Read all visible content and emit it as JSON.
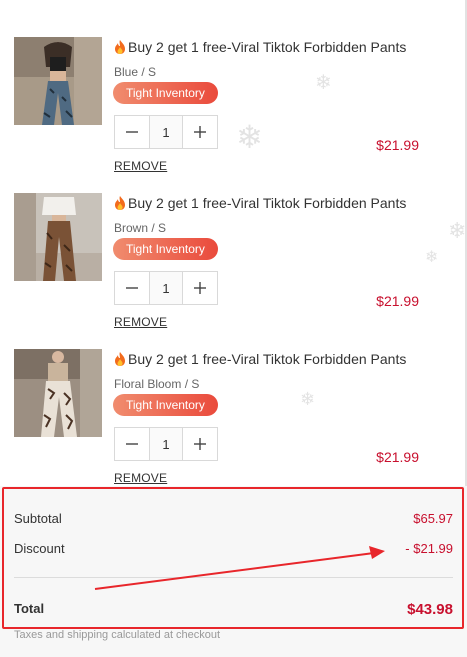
{
  "cart": {
    "items": [
      {
        "title": "Buy 2 get 1 free-Viral Tiktok Forbidden Pants",
        "variant": "Blue / S",
        "badge": "Tight Inventory",
        "quantity": "1",
        "price": "$21.99",
        "remove_label": "REMOVE",
        "image": "blue-pants-photo"
      },
      {
        "title": "Buy 2 get 1 free-Viral Tiktok Forbidden Pants",
        "variant": "Brown / S",
        "badge": "Tight Inventory",
        "quantity": "1",
        "price": "$21.99",
        "remove_label": "REMOVE",
        "image": "brown-pants-photo"
      },
      {
        "title": "Buy 2 get 1 free-Viral Tiktok Forbidden Pants",
        "variant": "Floral Bloom / S",
        "badge": "Tight Inventory",
        "quantity": "1",
        "price": "$21.99",
        "remove_label": "REMOVE",
        "image": "floral-pants-photo"
      }
    ]
  },
  "summary": {
    "subtotal_label": "Subtotal",
    "subtotal_value": "$65.97",
    "discount_label": "Discount",
    "discount_value": "- $21.99",
    "total_label": "Total",
    "total_value": "$43.98",
    "note": "Taxes and shipping calculated at checkout"
  },
  "colors": {
    "price": "#c8102e",
    "badge_start": "#f08c6e",
    "badge_end": "#ea4a3c",
    "highlight": "#e8262b"
  },
  "icons": [
    "fire-icon",
    "minus-icon",
    "plus-icon",
    "snowflake-icon"
  ]
}
